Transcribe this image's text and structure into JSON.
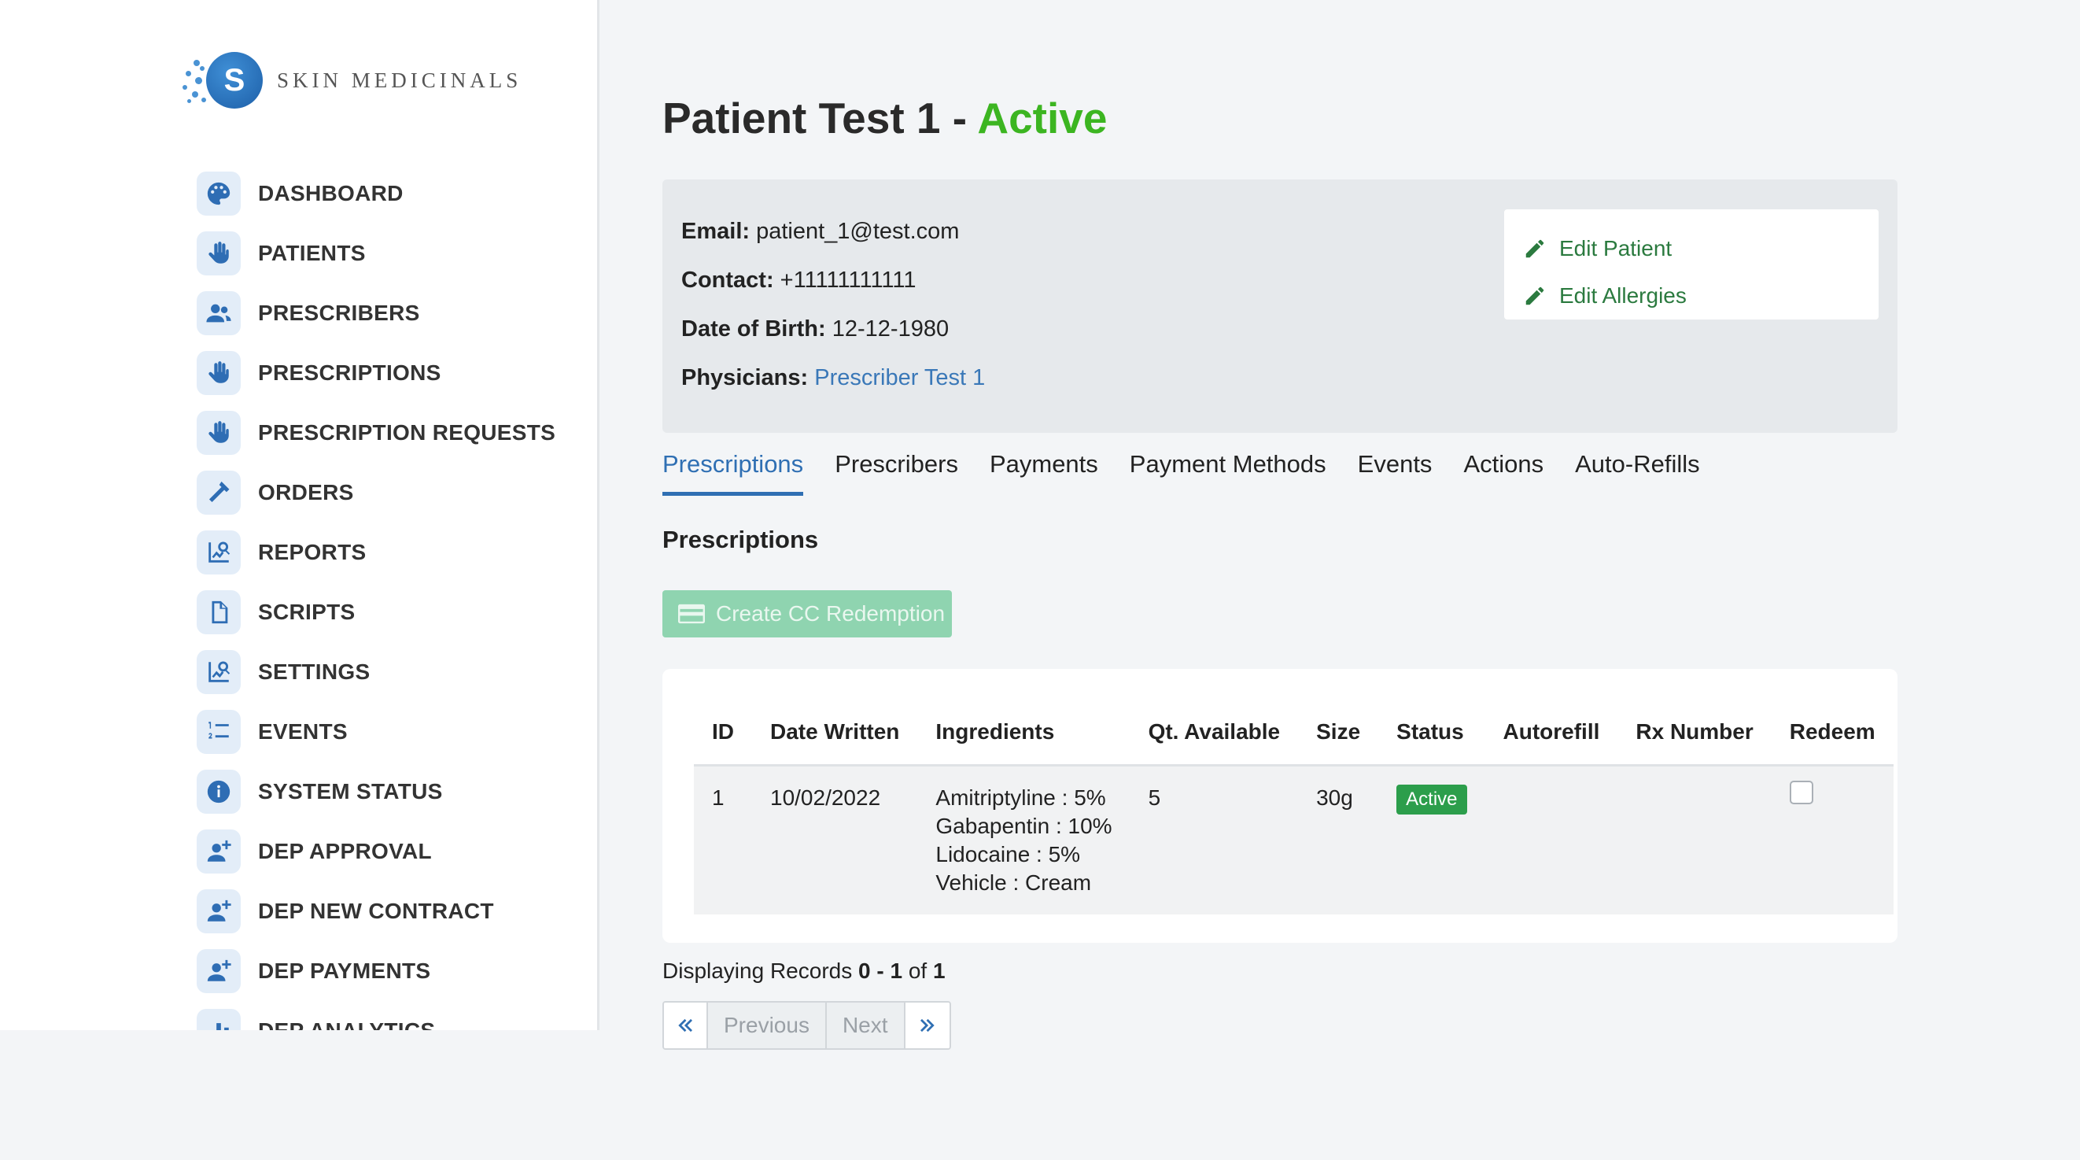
{
  "app": {
    "logo_letter": "S",
    "logo_text": "SKIN MEDICINALS"
  },
  "sidebar": {
    "items": [
      {
        "label": "DASHBOARD",
        "icon": "palette-icon"
      },
      {
        "label": "PATIENTS",
        "icon": "hand-icon"
      },
      {
        "label": "PRESCRIBERS",
        "icon": "users-icon"
      },
      {
        "label": "PRESCRIPTIONS",
        "icon": "hand-icon"
      },
      {
        "label": "PRESCRIPTION REQUESTS",
        "icon": "hand-icon"
      },
      {
        "label": "ORDERS",
        "icon": "hammer-icon"
      },
      {
        "label": "REPORTS",
        "icon": "chart-search-icon"
      },
      {
        "label": "SCRIPTS",
        "icon": "document-icon"
      },
      {
        "label": "SETTINGS",
        "icon": "chart-search-icon"
      },
      {
        "label": "EVENTS",
        "icon": "numbered-list-icon"
      },
      {
        "label": "SYSTEM STATUS",
        "icon": "info-icon"
      },
      {
        "label": "DEP APPROVAL",
        "icon": "user-plus-icon"
      },
      {
        "label": "DEP NEW CONTRACT",
        "icon": "user-plus-icon"
      },
      {
        "label": "DEP PAYMENTS",
        "icon": "user-plus-icon"
      },
      {
        "label": "DEP ANALYTICS",
        "icon": "bar-chart-icon"
      }
    ]
  },
  "header": {
    "title_name": "Patient Test 1",
    "title_separator": " - ",
    "title_status": "Active",
    "status_color": "#3cb521"
  },
  "patient": {
    "email_label": "Email:",
    "email": "patient_1@test.com",
    "contact_label": "Contact:",
    "contact": "+11111111111",
    "dob_label": "Date of Birth:",
    "dob": "12-12-1980",
    "physicians_label": "Physicians:",
    "physician": "Prescriber Test 1"
  },
  "actions": {
    "edit_patient": "Edit Patient",
    "edit_allergies": "Edit Allergies"
  },
  "tabs": [
    {
      "label": "Prescriptions",
      "active": true
    },
    {
      "label": "Prescribers"
    },
    {
      "label": "Payments"
    },
    {
      "label": "Payment Methods"
    },
    {
      "label": "Events"
    },
    {
      "label": "Actions"
    },
    {
      "label": "Auto-Refills"
    }
  ],
  "prescriptions": {
    "section_title": "Prescriptions",
    "create_button": "Create CC Redemption",
    "columns": [
      "ID",
      "Date Written",
      "Ingredients",
      "Qt. Available",
      "Size",
      "Status",
      "Autorefill",
      "Rx Number",
      "Redeem"
    ],
    "rows": [
      {
        "id": "1",
        "date_written": "10/02/2022",
        "ingredients": [
          "Amitriptyline : 5%",
          "Gabapentin : 10%",
          "Lidocaine : 5%",
          "Vehicle : Cream"
        ],
        "qt_available": "5",
        "size": "30g",
        "status": "Active",
        "autorefill": "",
        "rx_number": "",
        "redeem": false
      }
    ]
  },
  "pagination": {
    "prefix": "Displaying Records",
    "range": "0 - 1",
    "of": "of",
    "total": "1",
    "previous": "Previous",
    "next": "Next"
  }
}
